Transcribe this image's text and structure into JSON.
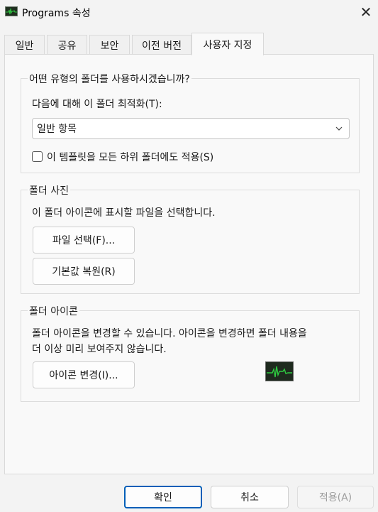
{
  "window": {
    "title": "Programs 속성",
    "icon": "activity-monitor-icon",
    "close_glyph": "✕"
  },
  "tabs": [
    {
      "label": "일반",
      "active": false
    },
    {
      "label": "공유",
      "active": false
    },
    {
      "label": "보안",
      "active": false
    },
    {
      "label": "이전 버전",
      "active": false
    },
    {
      "label": "사용자 지정",
      "active": true
    }
  ],
  "folder_type": {
    "title": "어떤 유형의 폴더를 사용하시겠습니까?",
    "optimize_label": "다음에 대해 이 폴더 최적화(T):",
    "selected_value": "일반 항목",
    "apply_subfolders_label": "이 템플릿을 모든 하위 폴더에도 적용(S)",
    "apply_subfolders_checked": false
  },
  "folder_picture": {
    "title": "폴더 사진",
    "description": "이 폴더 아이콘에 표시할 파일을 선택합니다.",
    "choose_file_label": "파일 선택(F)...",
    "restore_default_label": "기본값 복원(R)"
  },
  "folder_icon": {
    "title": "폴더 아이콘",
    "description_line1": "폴더 아이콘을 변경할 수 있습니다. 아이콘을 변경하면 폴더 내용을",
    "description_line2": "더 이상  미리 보여주지 않습니다.",
    "change_icon_label": "아이콘 변경(I)...",
    "preview_icon": "activity-monitor-icon"
  },
  "footer": {
    "ok_label": "확인",
    "cancel_label": "취소",
    "apply_label": "적용(A)",
    "apply_enabled": false
  },
  "colors": {
    "accent": "#005fb8",
    "icon_wave": "#2ecc40",
    "disabled_text": "#9c9c9c"
  }
}
